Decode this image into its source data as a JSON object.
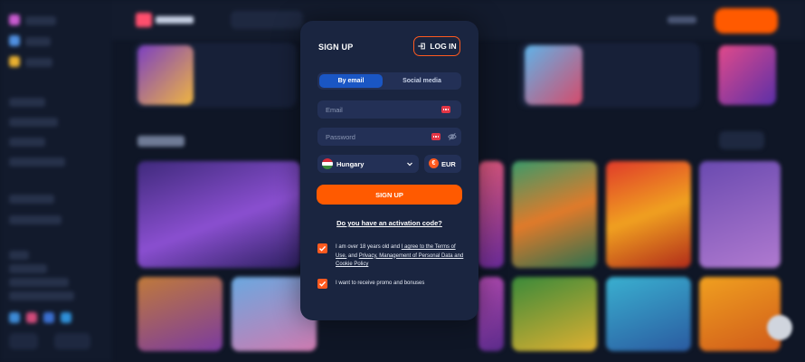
{
  "modal": {
    "title": "SIGN UP",
    "login_label": "LOG IN",
    "tabs": [
      {
        "label": "By email",
        "active": true
      },
      {
        "label": "Social media",
        "active": false
      }
    ],
    "email_placeholder": "Email",
    "password_placeholder": "Password",
    "country": "Hungary",
    "currency": "EUR",
    "currency_symbol": "€",
    "submit_label": "SIGN UP",
    "activation_link": "Do you have an activation code?",
    "terms": {
      "prefix": "I am over 18 years old and ",
      "link1": "I agree to the Terms of Use.",
      "middle": " and ",
      "link2": "Privacy, Management of Personal Data and Cookie Policy",
      "checked": true
    },
    "promo": {
      "label": "I want to receive promo and bonuses",
      "checked": true
    }
  },
  "colors": {
    "accent": "#ff5a00",
    "modal_bg": "#1a2540",
    "field_bg": "#233056",
    "tab_active": "#1a56c4",
    "page_bg": "#0f1626"
  },
  "icons": [
    "login-icon",
    "password-manager-icon",
    "eye-off-icon",
    "hungary-flag-icon",
    "chevron-down-icon",
    "euro-icon",
    "checkmark-icon"
  ]
}
